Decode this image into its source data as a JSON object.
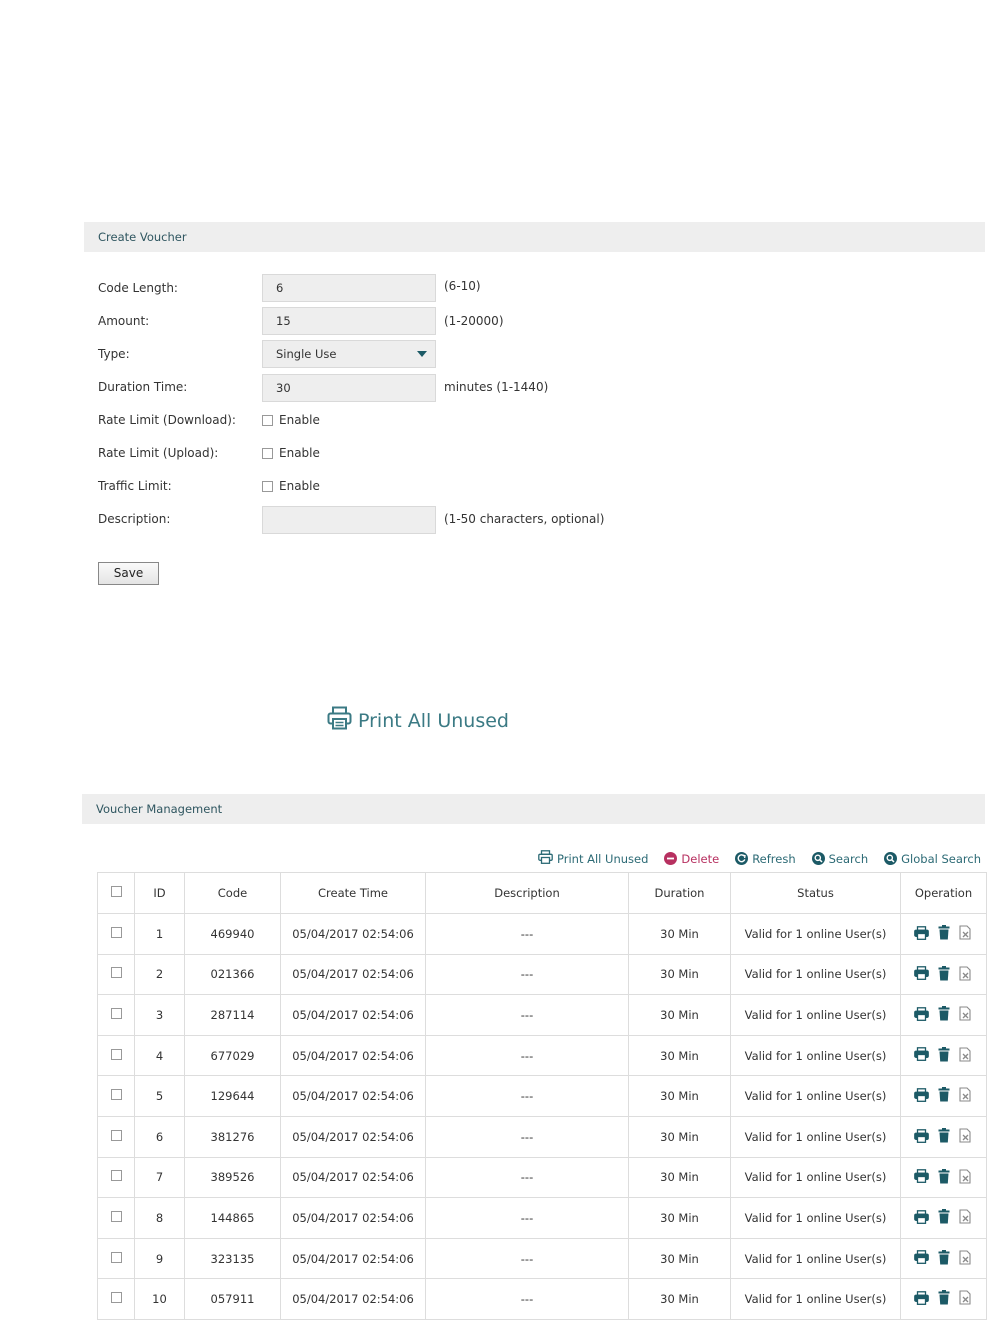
{
  "create_voucher": {
    "title": "Create Voucher",
    "code_length": {
      "label": "Code Length:",
      "value": "6",
      "hint": "(6-10)"
    },
    "amount": {
      "label": "Amount:",
      "value": "15",
      "hint": "(1-20000)"
    },
    "type": {
      "label": "Type:",
      "value": "Single Use"
    },
    "duration_time": {
      "label": "Duration Time:",
      "value": "30",
      "hint": "minutes (1-1440)"
    },
    "rate_limit_download": {
      "label": "Rate Limit (Download):",
      "checkbox_label": "Enable",
      "checked": false
    },
    "rate_limit_upload": {
      "label": "Rate Limit (Upload):",
      "checkbox_label": "Enable",
      "checked": false
    },
    "traffic_limit": {
      "label": "Traffic Limit:",
      "checkbox_label": "Enable",
      "checked": false
    },
    "description": {
      "label": "Description:",
      "value": "",
      "hint": "(1-50 characters, optional)"
    },
    "save_label": "Save"
  },
  "print_all_unused_big": "Print All Unused",
  "voucher_management": {
    "title": "Voucher Management",
    "toolbar": {
      "print_all_unused": "Print All Unused",
      "delete": "Delete",
      "refresh": "Refresh",
      "search": "Search",
      "global_search": "Global Search"
    },
    "columns": [
      "ID",
      "Code",
      "Create Time",
      "Description",
      "Duration",
      "Status",
      "Operation"
    ],
    "rows": [
      {
        "id": "1",
        "code": "469940",
        "create_time": "05/04/2017 02:54:06",
        "description": "---",
        "duration": "30 Min",
        "status": "Valid for 1 online User(s)"
      },
      {
        "id": "2",
        "code": "021366",
        "create_time": "05/04/2017 02:54:06",
        "description": "---",
        "duration": "30 Min",
        "status": "Valid for 1 online User(s)"
      },
      {
        "id": "3",
        "code": "287114",
        "create_time": "05/04/2017 02:54:06",
        "description": "---",
        "duration": "30 Min",
        "status": "Valid for 1 online User(s)"
      },
      {
        "id": "4",
        "code": "677029",
        "create_time": "05/04/2017 02:54:06",
        "description": "---",
        "duration": "30 Min",
        "status": "Valid for 1 online User(s)"
      },
      {
        "id": "5",
        "code": "129644",
        "create_time": "05/04/2017 02:54:06",
        "description": "---",
        "duration": "30 Min",
        "status": "Valid for 1 online User(s)"
      },
      {
        "id": "6",
        "code": "381276",
        "create_time": "05/04/2017 02:54:06",
        "description": "---",
        "duration": "30 Min",
        "status": "Valid for 1 online User(s)"
      },
      {
        "id": "7",
        "code": "389526",
        "create_time": "05/04/2017 02:54:06",
        "description": "---",
        "duration": "30 Min",
        "status": "Valid for 1 online User(s)"
      },
      {
        "id": "8",
        "code": "144865",
        "create_time": "05/04/2017 02:54:06",
        "description": "---",
        "duration": "30 Min",
        "status": "Valid for 1 online User(s)"
      },
      {
        "id": "9",
        "code": "323135",
        "create_time": "05/04/2017 02:54:06",
        "description": "---",
        "duration": "30 Min",
        "status": "Valid for 1 online User(s)"
      },
      {
        "id": "10",
        "code": "057911",
        "create_time": "05/04/2017 02:54:06",
        "description": "---",
        "duration": "30 Min",
        "status": "Valid for 1 online User(s)"
      }
    ],
    "row_operations": [
      "print-icon",
      "delete-icon",
      "revoke-icon"
    ]
  },
  "colors": {
    "accent": "#1c5a66",
    "link": "#2c6a75",
    "delete": "#b73060",
    "header_bg": "#eeeeee"
  }
}
